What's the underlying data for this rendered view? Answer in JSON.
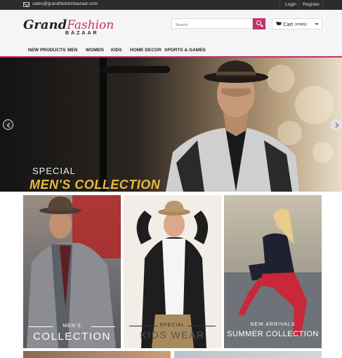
{
  "topbar": {
    "email": "sales@grandfashionbazaar.com",
    "login": "Login",
    "register": "Register"
  },
  "logo": {
    "grand": "Grand",
    "fashion": "Fashion",
    "bazaar": "BAZAAR"
  },
  "search": {
    "placeholder": "Search"
  },
  "cart": {
    "label": "Cart",
    "status": "(empty)"
  },
  "nav": {
    "items": [
      "NEW PRODUCTS",
      "MEN",
      "WOMEN",
      "KIDS",
      "HOME DECOR",
      "SPORTS & GAMES"
    ]
  },
  "banner": {
    "small": "SPECIAL",
    "title": "MEN'S COLLECTION"
  },
  "tiles": [
    {
      "small": "MEN'S",
      "big": "COLLECTION"
    },
    {
      "small": "SPECIAL",
      "big": "KIDS WEAR"
    },
    {
      "small": "NEW ARRIVALS",
      "big": "SUMMER COLLECTION"
    }
  ],
  "colors": {
    "accent": "#c0336e",
    "banner_title": "#e9b93c",
    "topbar": "#2b2b2b"
  }
}
